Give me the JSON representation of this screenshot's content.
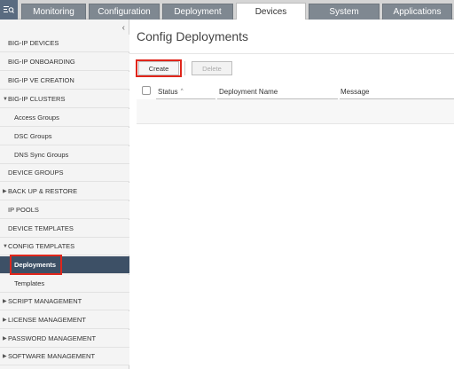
{
  "topnav": {
    "menu_icon": "list-search-icon",
    "tabs": [
      {
        "label": "Monitoring",
        "active": false
      },
      {
        "label": "Configuration",
        "active": false
      },
      {
        "label": "Deployment",
        "active": false
      },
      {
        "label": "Devices",
        "active": true
      },
      {
        "label": "System",
        "active": false
      },
      {
        "label": "Applications",
        "active": false
      }
    ]
  },
  "sidebar": {
    "collapse_icon": "chevron-left-icon",
    "items": [
      {
        "label": "BIG-IP DEVICES"
      },
      {
        "label": "BIG-IP ONBOARDING"
      },
      {
        "label": "BIG-IP VE CREATION"
      },
      {
        "label": "BIG-IP CLUSTERS",
        "expanded": true
      },
      {
        "label": "Access Groups"
      },
      {
        "label": "DSC Groups"
      },
      {
        "label": "DNS Sync Groups"
      },
      {
        "label": "DEVICE GROUPS"
      },
      {
        "label": "BACK UP & RESTORE",
        "expanded": false
      },
      {
        "label": "IP POOLS"
      },
      {
        "label": "DEVICE TEMPLATES"
      },
      {
        "label": "CONFIG TEMPLATES",
        "expanded": true
      },
      {
        "label": "Deployments",
        "selected": true
      },
      {
        "label": "Templates"
      },
      {
        "label": "SCRIPT MANAGEMENT",
        "expanded": false
      },
      {
        "label": "LICENSE MANAGEMENT",
        "expanded": false
      },
      {
        "label": "PASSWORD MANAGEMENT",
        "expanded": false
      },
      {
        "label": "SOFTWARE MANAGEMENT",
        "expanded": false
      }
    ]
  },
  "main": {
    "title": "Config Deployments",
    "buttons": {
      "create": "Create",
      "delete": "Delete"
    },
    "columns": [
      "Status",
      "Deployment Name",
      "Message"
    ],
    "sort_indicator": "^"
  },
  "colors": {
    "highlight": "#e0261b",
    "selected_bg": "#3d5066",
    "tab_bg": "#7f8891"
  }
}
